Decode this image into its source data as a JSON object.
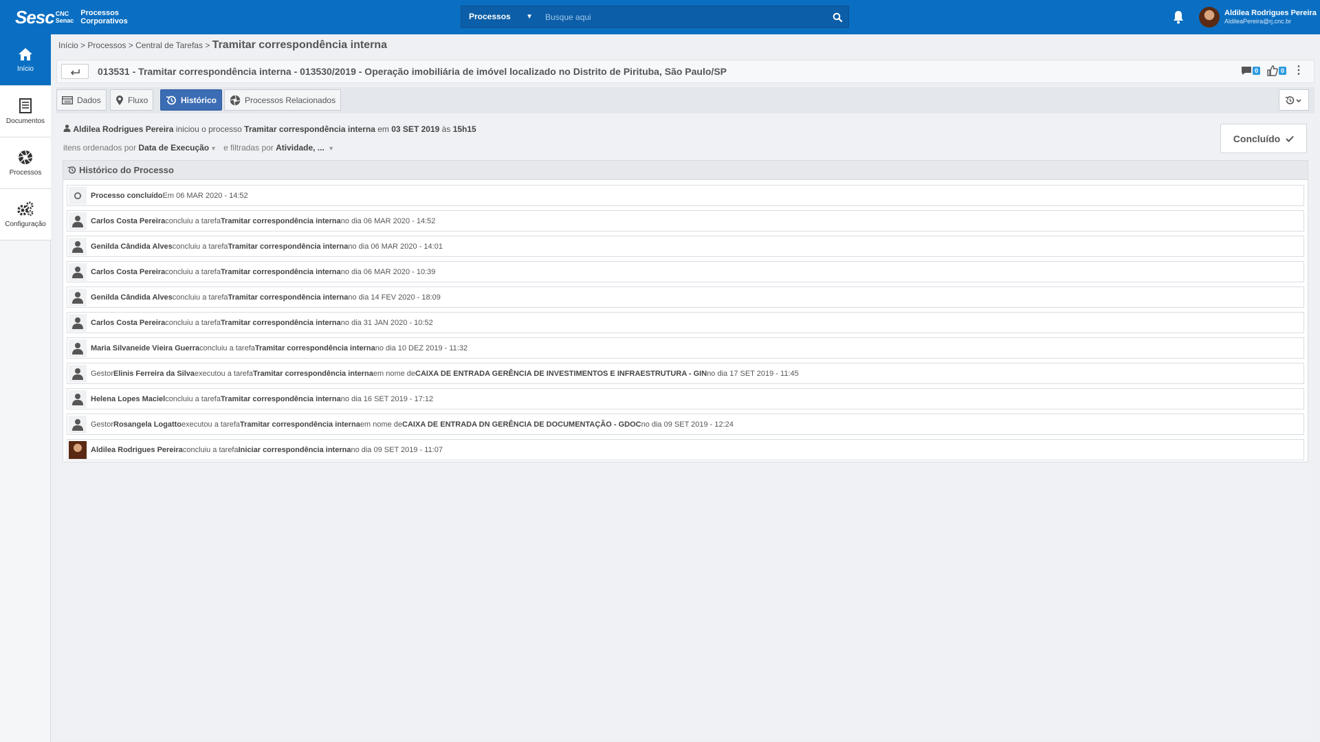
{
  "topbar": {
    "logo_main": "Sesc",
    "logo_cnc": "CNC",
    "logo_senac": "Senac",
    "app_line1": "Processos",
    "app_line2": "Corporativos",
    "search_scope": "Processos",
    "search_placeholder": "Busque aqui",
    "user_name": "Aldilea Rodrigues Pereira",
    "user_email": "AldileaPereira@rj.cnc.br"
  },
  "sidebar": {
    "items": [
      {
        "label": "Início",
        "icon": "home-icon",
        "active": true
      },
      {
        "label": "Documentos",
        "icon": "document-icon",
        "active": false
      },
      {
        "label": "Processos",
        "icon": "aperture-icon",
        "active": false
      },
      {
        "label": "Configuração",
        "icon": "gears-icon",
        "active": false
      }
    ]
  },
  "breadcrumb": {
    "crumbs": [
      "Início",
      "Processos",
      "Central de Tarefas"
    ],
    "separator": ">",
    "current": "Tramitar correspondência interna"
  },
  "title_bar": {
    "title": "013531 - Tramitar correspondência interna - 013530/2019 - Operação imobiliária de imóvel localizado no Distrito de Pirituba, São Paulo/SP",
    "comments_count": "0",
    "likes_count": "0"
  },
  "tabs": [
    {
      "label": "Dados",
      "icon": "table-icon",
      "active": false
    },
    {
      "label": "Fluxo",
      "icon": "map-pin-icon",
      "active": false
    },
    {
      "label": "Histórico",
      "icon": "history-icon",
      "active": true
    },
    {
      "label": "Processos Relacionados",
      "icon": "aperture-icon",
      "active": false
    }
  ],
  "summary": {
    "starter": "Aldilea Rodrigues Pereira",
    "started_text": "iniciou o processo",
    "process": "Tramitar correspondência interna",
    "on_text": "em",
    "date": "03 SET 2019",
    "at_text": "às",
    "time": "15h15",
    "sorted_label": "itens ordenados por",
    "sorted_value": "Data de Execução",
    "filtered_label": "e filtradas por",
    "filtered_value": "Atividade, ..."
  },
  "status_button": {
    "label": "Concluído"
  },
  "history": {
    "title": "Histórico do Processo",
    "rows": [
      {
        "type": "status",
        "bold1": "Processo concluído",
        "text1": "Em 06 MAR 2020 - 14:52"
      },
      {
        "type": "user",
        "bold1": "Carlos Costa Pereira",
        "text1": "concluiu a tarefa",
        "bold2": "Tramitar correspondência interna",
        "text2": "no dia 06 MAR 2020 - 14:52"
      },
      {
        "type": "user",
        "bold1": "Genilda Cândida Alves",
        "text1": "concluiu a tarefa",
        "bold2": "Tramitar correspondência interna",
        "text2": "no dia 06 MAR 2020 - 14:01"
      },
      {
        "type": "user",
        "bold1": "Carlos Costa Pereira",
        "text1": "concluiu a tarefa",
        "bold2": "Tramitar correspondência interna",
        "text2": "no dia 06 MAR 2020 - 10:39"
      },
      {
        "type": "user",
        "bold1": "Genilda Cândida Alves",
        "text1": "concluiu a tarefa",
        "bold2": "Tramitar correspondência interna",
        "text2": "no dia 14 FEV 2020 - 18:09"
      },
      {
        "type": "user",
        "bold1": "Carlos Costa Pereira",
        "text1": "concluiu a tarefa",
        "bold2": "Tramitar correspondência interna",
        "text2": "no dia 31 JAN 2020 - 10:52"
      },
      {
        "type": "user",
        "bold1": "Maria Silvaneide Vieira Guerra",
        "text1": "concluiu a tarefa",
        "bold2": "Tramitar correspondência interna",
        "text2": "no dia 10 DEZ 2019 - 11:32"
      },
      {
        "type": "user",
        "prefix": "Gestor",
        "bold1": "Elinis Ferreira da Silva",
        "text1": "executou a tarefa",
        "bold2": "Tramitar correspondência interna",
        "text2": "em nome de",
        "bold3": "CAIXA DE ENTRADA GERÊNCIA DE INVESTIMENTOS E INFRAESTRUTURA - GIN",
        "text3": "no dia 17 SET 2019 - 11:45"
      },
      {
        "type": "user",
        "bold1": "Helena Lopes Maciel",
        "text1": "concluiu a tarefa",
        "bold2": "Tramitar correspondência interna",
        "text2": "no dia 16 SET 2019 - 17:12"
      },
      {
        "type": "user",
        "prefix": "Gestor",
        "bold1": "Rosangela Logatto",
        "text1": "executou a tarefa",
        "bold2": "Tramitar correspondência interna",
        "text2": "em nome de",
        "bold3": "CAIXA DE ENTRADA DN GERÊNCIA DE DOCUMENTAÇÃO - GDOC",
        "text3": "no dia 09 SET 2019 - 12:24"
      },
      {
        "type": "photo",
        "bold1": "Aldilea Rodrigues Pereira",
        "text1": "concluiu a tarefa",
        "bold2": "Iniciar correspondência interna",
        "text2": "no dia 09 SET 2019 - 11:07"
      }
    ]
  },
  "colors": {
    "brand_blue": "#0a6fc2",
    "active_tab": "#3b6cb4",
    "badge": "#2d9be0"
  }
}
